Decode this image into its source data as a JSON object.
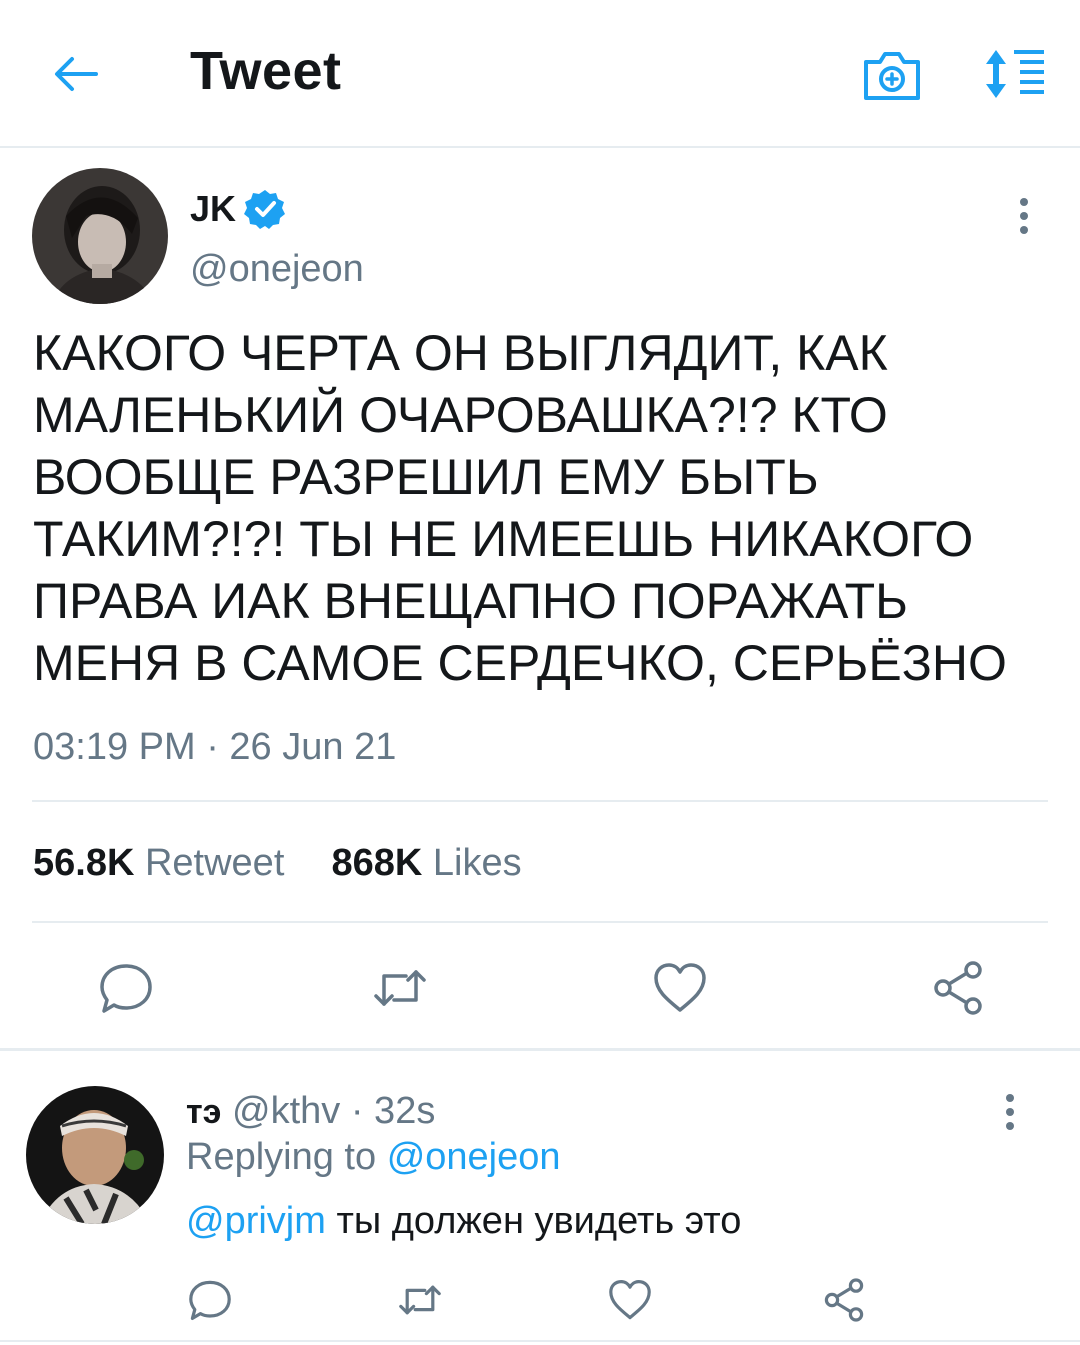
{
  "header": {
    "title": "Tweet",
    "back_icon": "arrow-left-icon",
    "camera_icon": "camera-icon",
    "sort_icon": "sort-list-icon",
    "accent": "#1da1f2"
  },
  "tweet": {
    "display_name": "JK",
    "verified": true,
    "handle": "@onejeon",
    "text_lines": [
      "КАКОГО ЧЕРТА ОН ВЫГЛЯДИТ, КАК",
      "МАЛЕНЬКИЙ ОЧАРОВАШКА?!? КТО",
      "ВООБЩЕ РАЗРЕШИЛ ЕМУ БЫТЬ",
      "ТАКИМ?!?! ТЫ НЕ ИМЕЕШЬ НИКАКОГО",
      "ПРАВА ИАК ВНЕЩАПНО ПОРАЖАТЬ",
      "МЕНЯ В САМОЕ СЕРДЕЧКО, СЕРЬЁЗНО"
    ],
    "timestamp": "03:19 PM · 26 Jun 21",
    "retweets_count": "56.8K",
    "retweets_label": "Retweet",
    "likes_count": "868K",
    "likes_label": "Likes"
  },
  "reply": {
    "display_name": "тэ",
    "handle": "@kthv",
    "age": "· 32s",
    "replying_prefix": "Replying to",
    "replying_to": "@onejeon",
    "mention": "@privjm",
    "text": "ты должен увидеть это"
  },
  "colors": {
    "text": "#14171a",
    "secondary": "#657786",
    "accent": "#1da1f2",
    "divider": "#e6ecf0"
  }
}
